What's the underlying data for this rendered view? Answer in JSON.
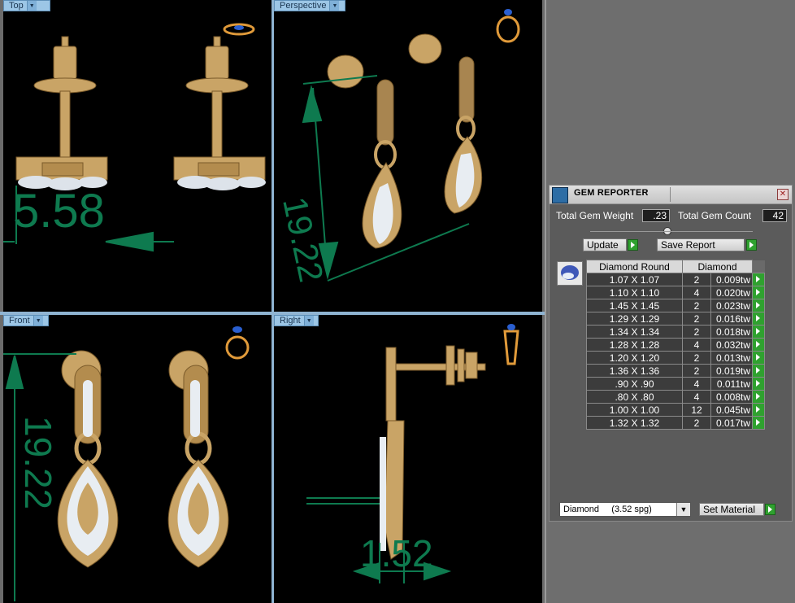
{
  "viewports": {
    "top": {
      "label": "Top",
      "dim": "5.58"
    },
    "perspective": {
      "label": "Perspective",
      "dim": "19.22"
    },
    "front": {
      "label": "Front",
      "dim": "19.22"
    },
    "right": {
      "label": "Right",
      "dim": "1.52"
    }
  },
  "gem_reporter": {
    "title": "GEM REPORTER",
    "close": "✕",
    "total_gem_weight_label": "Total Gem Weight",
    "total_gem_weight": ".23",
    "total_gem_count_label": "Total Gem Count",
    "total_gem_count": "42",
    "update_label": "Update",
    "save_report_label": "Save Report",
    "columns": [
      "Diamond Round",
      "Diamond"
    ],
    "rows": [
      {
        "size": "1.07 X 1.07",
        "count": "2",
        "tw": "0.009tw"
      },
      {
        "size": "1.10 X 1.10",
        "count": "4",
        "tw": "0.020tw"
      },
      {
        "size": "1.45 X 1.45",
        "count": "2",
        "tw": "0.023tw"
      },
      {
        "size": "1.29 X 1.29",
        "count": "2",
        "tw": "0.016tw"
      },
      {
        "size": "1.34 X 1.34",
        "count": "2",
        "tw": "0.018tw"
      },
      {
        "size": "1.28 X 1.28",
        "count": "4",
        "tw": "0.032tw"
      },
      {
        "size": "1.20 X 1.20",
        "count": "2",
        "tw": "0.013tw"
      },
      {
        "size": "1.36 X 1.36",
        "count": "2",
        "tw": "0.019tw"
      },
      {
        "size": ".90 X .90",
        "count": "4",
        "tw": "0.011tw"
      },
      {
        "size": ".80 X .80",
        "count": "4",
        "tw": "0.008tw"
      },
      {
        "size": "1.00 X 1.00",
        "count": "12",
        "tw": "0.045tw"
      },
      {
        "size": "1.32 X 1.32",
        "count": "2",
        "tw": "0.017tw"
      }
    ],
    "material": "Diamond     (3.52 spg)",
    "set_material_label": "Set Material"
  },
  "colors": {
    "gold": "#c9a466",
    "dim_green": "#0e7a4f",
    "viewport_tab": "#9cc6e6"
  }
}
